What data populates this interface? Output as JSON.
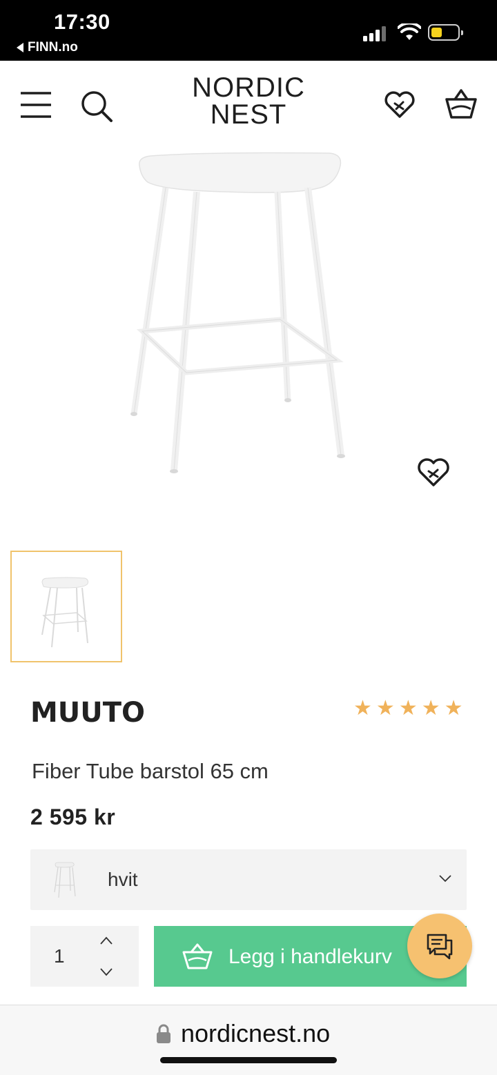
{
  "status_bar": {
    "time": "17:30",
    "back_app": "FINN.no",
    "battery_color": "#f6d31e"
  },
  "header": {
    "logo_line1": "NORDIC",
    "logo_line2": "NEST",
    "icons": [
      "menu-icon",
      "search-icon",
      "wishlist-heart-icon",
      "basket-icon"
    ]
  },
  "product": {
    "brand": "MUUTO",
    "rating_stars": 5,
    "stars": [
      "★",
      "★",
      "★",
      "★",
      "★"
    ],
    "name": "Fiber Tube barstol 65 cm",
    "price": "2 595 kr",
    "variant": {
      "selected": "hvit"
    },
    "quantity": "1",
    "add_to_cart_label": "Legg i handlekurv"
  },
  "colors": {
    "accent_green": "#57c98f",
    "star_color": "#f0b25a",
    "thumb_border": "#f0c36b",
    "chat_bubble": "#f6c170"
  },
  "browser": {
    "url": "nordicnest.no"
  }
}
